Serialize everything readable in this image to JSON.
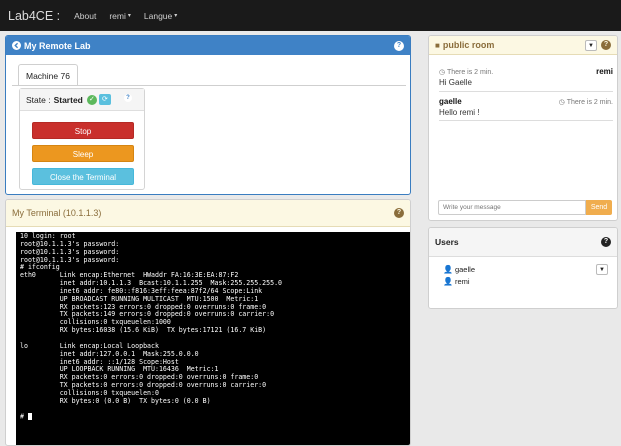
{
  "navbar": {
    "brand": "Lab4CE :",
    "items": [
      {
        "label": "About",
        "caret": ""
      },
      {
        "label": "remi",
        "caret": "▾"
      },
      {
        "label": "Langue",
        "caret": "▾"
      }
    ]
  },
  "lab": {
    "title": "My Remote Lab",
    "tab": "Machine 76",
    "state_label": "State :",
    "state_value": "Started",
    "buttons": {
      "stop": "Stop",
      "sleep": "Sleep",
      "close": "Close the Terminal"
    }
  },
  "terminal": {
    "title": "My Terminal  (10.1.1.3)",
    "lines": [
      "10 login: root",
      "root@10.1.1.3's password:",
      "root@10.1.1.3's password:",
      "root@10.1.1.3's password:",
      "# ifconfig",
      "eth0      Link encap:Ethernet  HWaddr FA:16:3E:EA:87:F2",
      "          inet addr:10.1.1.3  Bcast:10.1.1.255  Mask:255.255.255.0",
      "          inet6 addr: fe80::f816:3eff:feea:87f2/64 Scope:Link",
      "          UP BROADCAST RUNNING MULTICAST  MTU:1500  Metric:1",
      "          RX packets:123 errors:0 dropped:0 overruns:0 frame:0",
      "          TX packets:149 errors:0 dropped:0 overruns:0 carrier:0",
      "          collisions:0 txqueuelen:1000",
      "          RX bytes:16038 (15.6 KiB)  TX bytes:17121 (16.7 KiB)",
      "",
      "lo        Link encap:Local Loopback",
      "          inet addr:127.0.0.1  Mask:255.0.0.0",
      "          inet6 addr: ::1/128 Scope:Host",
      "          UP LOOPBACK RUNNING  MTU:16436  Metric:1",
      "          RX packets:0 errors:0 dropped:0 overruns:0 frame:0",
      "          TX packets:0 errors:0 dropped:0 overruns:0 carrier:0",
      "          collisions:0 txqueuelen:0",
      "          RX bytes:0 (0.0 B)  TX bytes:0 (0.0 B)",
      "",
      "# "
    ]
  },
  "room": {
    "title": "public room",
    "messages": [
      {
        "time": "There is 2 min.",
        "user": "remi",
        "text": "Hi Gaelle"
      },
      {
        "time": "There is 2 min.",
        "user": "gaelle",
        "text": "Hello remi !"
      }
    ],
    "input_placeholder": "Write your message",
    "send_label": "Send"
  },
  "users": {
    "title": "Users",
    "list": [
      "gaelle",
      "remi"
    ]
  },
  "colors": {
    "primary": "#3f82c6",
    "danger": "#c9302c",
    "warning": "#ec971f",
    "info": "#5bc0de",
    "success": "#5cb85c"
  }
}
